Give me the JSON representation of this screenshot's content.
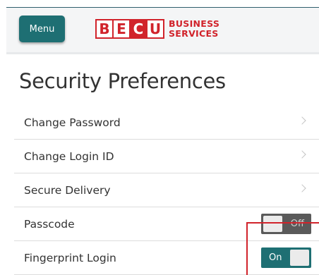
{
  "header": {
    "menu_label": "Menu",
    "logo_letters": [
      "B",
      "E",
      "C",
      "U"
    ],
    "logo_line1": "BUSINESS",
    "logo_line2": "SERVICES",
    "brand_color": "#d1232b",
    "accent_color": "#1e6f73"
  },
  "page": {
    "title": "Security Preferences"
  },
  "items": [
    {
      "label": "Change Password",
      "type": "nav",
      "icon": "chevron-right-icon"
    },
    {
      "label": "Change Login ID",
      "type": "nav",
      "icon": "chevron-right-icon"
    },
    {
      "label": "Secure Delivery",
      "type": "nav",
      "icon": "chevron-right-icon"
    },
    {
      "label": "Passcode",
      "type": "toggle",
      "state_label": "Off"
    },
    {
      "label": "Fingerprint Login",
      "type": "toggle",
      "state_label": "On"
    }
  ]
}
